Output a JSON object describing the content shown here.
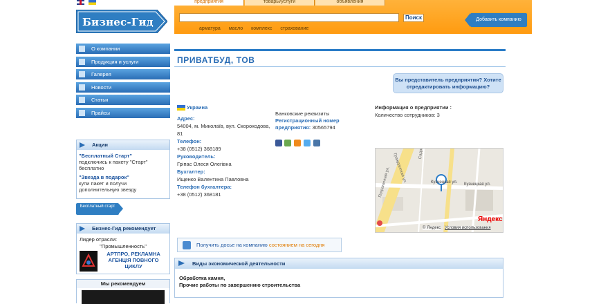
{
  "header": {
    "tabs": [
      "предприятия",
      "товары/услуги",
      "объявления"
    ],
    "search_placeholder": "",
    "search_button": "Поиск",
    "add_company": "Добавить компанию",
    "keywords": [
      "арматура",
      "масло",
      "комплекс",
      "страхование"
    ]
  },
  "logo": {
    "text": "Бизнес-Гид"
  },
  "nav": {
    "items": [
      "О компании",
      "Продукция и услуги",
      "Галерея",
      "Новости",
      "Статьи",
      "Прайсы"
    ]
  },
  "actions": {
    "title": "Акции",
    "promo1_title": "\"Бесплатный Старт\"",
    "promo1_text": "подключись к пакету \"Старт\" бесплатно",
    "promo2_title": "\"Звезда в подарок\"",
    "promo2_text": "купи пакет и получи дополнительную звезду",
    "start_button": "Бесплатный старт"
  },
  "recommends": {
    "title": "Бизнес-Гид рекомендует",
    "leader": "Лидер отрасли:",
    "industry": "\"Промышленность\"",
    "company": "АРТПРО, РЕКЛАМНА АГЕНЦІЯ ПОВНОГО ЦИКЛУ"
  },
  "we_recommend": {
    "title": "Мы рекомендуем"
  },
  "company": {
    "name": "ПРИВАТБУД, ТОВ",
    "rep_question": "Вы представитель предприятия? Хотите отредактировать информацию?",
    "country": "Украина",
    "address_label": "Адрес:",
    "address": "54004, м. Миколаїв, вул. Скороходова, 81",
    "phone_label": "Телефон:",
    "phone": "+38 (0512) 368189",
    "director_label": "Руководитель:",
    "director": "Гріпас Олеся Олегівна",
    "accountant_label": "Бухгалтер:",
    "accountant": "Ищенко Валентина Павловна",
    "accountant_phone_label": "Телефон бухгалтера:",
    "accountant_phone": "+38 (0512) 368181",
    "bank_label": "Банковские реквизиты",
    "reg_label": "Регистрационный номер предприятия:",
    "reg_number": "30565794",
    "info_label": "Информация о предприятии :",
    "employees": "Количество сотрудников: 3"
  },
  "map": {
    "street1": "Садовая ул.",
    "street2": "Кузнецкая ул.",
    "street3": "Кузнецкая ул.",
    "street4": "Кузнецкая ул.",
    "street5": "Гражданская ул.",
    "street6": "Пограничная ул.",
    "brand": "Яндекс",
    "terms": "Условия использования",
    "yandex_small": "© Яндекс"
  },
  "dossier": {
    "part1": "Получить досье на компанию ",
    "part2": "состоянием на сегодня"
  },
  "econ": {
    "title": "Виды экономической деятельности",
    "line1": "Обработка камня,",
    "line2": "Прочие работы по завершению строительства"
  }
}
